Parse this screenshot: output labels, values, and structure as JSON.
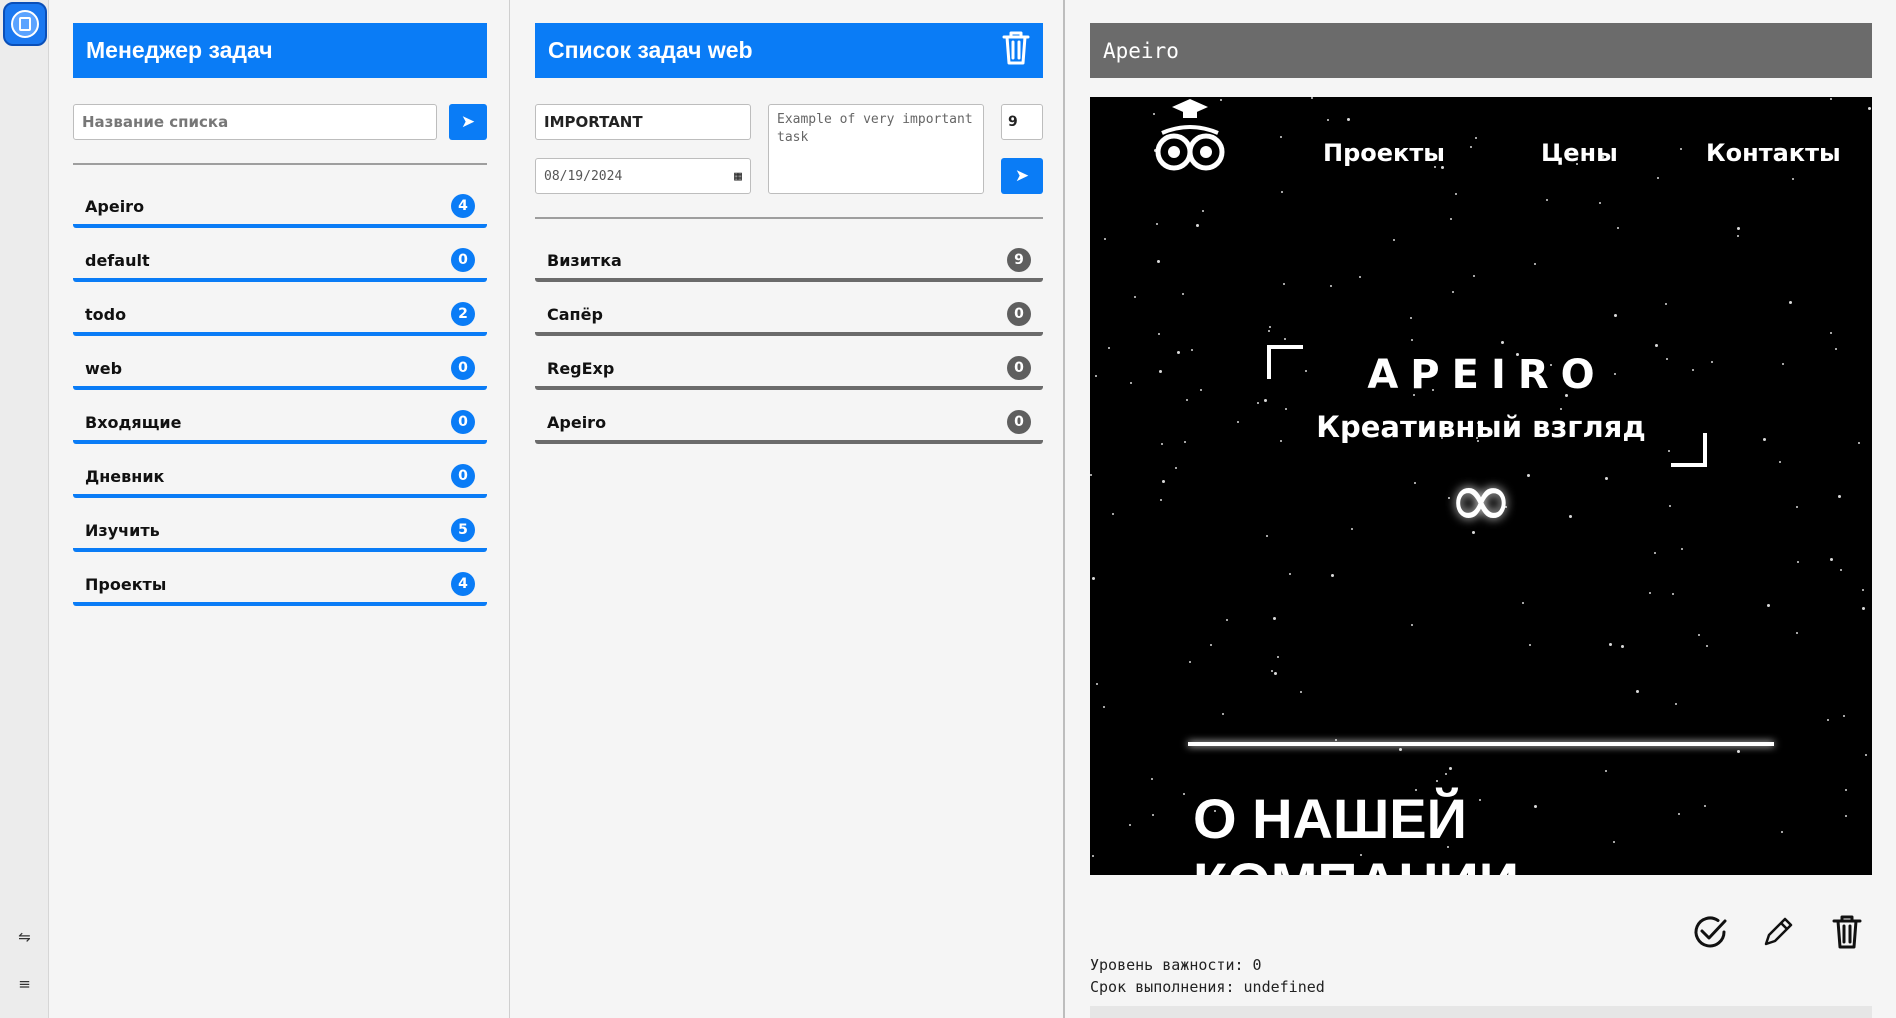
{
  "manager": {
    "title": "Менеджер задач",
    "new_list_placeholder": "Название списка",
    "lists": [
      {
        "name": "Apeiro",
        "count": "4"
      },
      {
        "name": "default",
        "count": "0"
      },
      {
        "name": "todo",
        "count": "2"
      },
      {
        "name": "web",
        "count": "0"
      },
      {
        "name": "Входящие",
        "count": "0"
      },
      {
        "name": "Дневник",
        "count": "0"
      },
      {
        "name": "Изучить",
        "count": "5"
      },
      {
        "name": "Проекты",
        "count": "4"
      }
    ]
  },
  "tasklist": {
    "title": "Список задач web",
    "task_title_value": "IMPORTANT",
    "description_placeholder": "Example of very important task",
    "priority_value": "9",
    "date_value": "08/19/2024",
    "tasks": [
      {
        "name": "Визитка",
        "count": "9"
      },
      {
        "name": "Сапёр",
        "count": "0"
      },
      {
        "name": "RegExp",
        "count": "0"
      },
      {
        "name": "Apeiro",
        "count": "0"
      }
    ]
  },
  "detail": {
    "title": "Apeiro",
    "preview": {
      "nav": [
        "Проекты",
        "Цены",
        "Контакты"
      ],
      "brand": "APEIRO",
      "tagline": "Креативный взгляд",
      "infinity": "∞",
      "section_heading_line1": "О НАШЕЙ",
      "section_heading_line2": "КОМПАНИИ"
    },
    "importance_line": "Уровень важности: 0",
    "due_line": "Срок выполнения: undefined"
  },
  "colors": {
    "accent": "#0a7cf6",
    "grey_header": "#6b6b6b"
  },
  "icons": {
    "go": "arrow-right-icon",
    "delete": "trash-icon",
    "done": "check-circle-icon",
    "edit": "pencil-icon"
  }
}
